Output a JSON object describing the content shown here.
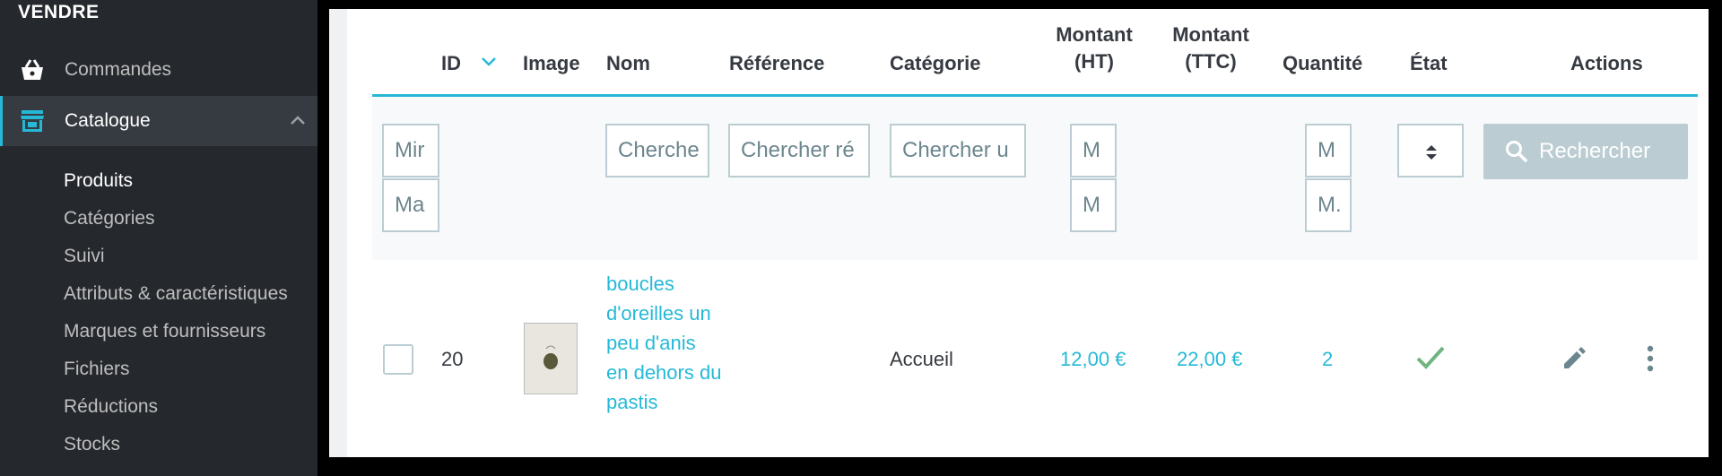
{
  "sidebar": {
    "section_title": "VENDRE",
    "nav": [
      {
        "label": "Commandes",
        "icon": "basket-icon"
      },
      {
        "label": "Catalogue",
        "icon": "store-icon"
      }
    ],
    "subnav": [
      {
        "label": "Produits",
        "active": true
      },
      {
        "label": "Catégories"
      },
      {
        "label": "Suivi"
      },
      {
        "label": "Attributs & caractéristiques"
      },
      {
        "label": "Marques et fournisseurs"
      },
      {
        "label": "Fichiers"
      },
      {
        "label": "Réductions"
      },
      {
        "label": "Stocks"
      }
    ]
  },
  "table": {
    "headers": {
      "id": "ID",
      "image": "Image",
      "nom": "Nom",
      "reference": "Référence",
      "categorie": "Catégorie",
      "montant_ht_1": "Montant",
      "montant_ht_2": "(HT)",
      "montant_ttc_1": "Montant",
      "montant_ttc_2": "(TTC)",
      "quantite": "Quantité",
      "etat": "État",
      "actions": "Actions"
    },
    "filters": {
      "id_min": "Mir",
      "id_max": "Ma",
      "nom": "Cherche",
      "reference": "Chercher ré",
      "categorie": "Chercher u",
      "ht_min": "M",
      "ht_max": "M",
      "qty_min": "M",
      "qty_max": "M.",
      "search_button": "Rechercher"
    },
    "rows": [
      {
        "id": "20",
        "name": "boucles d'oreilles un peu d'anis en dehors du pastis",
        "category": "Accueil",
        "price_ht": "12,00 €",
        "price_ttc": "22,00 €",
        "quantity": "2"
      }
    ]
  },
  "colors": {
    "accent": "#25b9d7",
    "sidebar_bg": "#25282d",
    "status_ok": "#70b580"
  }
}
